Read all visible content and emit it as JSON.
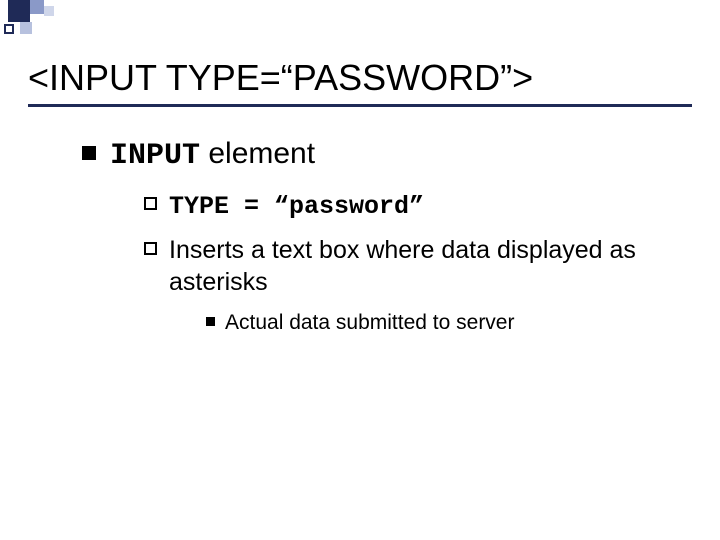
{
  "title": "<INPUT TYPE=“PASSWORD”>",
  "l1": {
    "prefix_mono": "INPUT",
    "suffix": " element"
  },
  "l2a": {
    "mono": "TYPE = “password”"
  },
  "l2b": {
    "text": "Inserts a text box where data displayed as asterisks"
  },
  "l3a": {
    "text": "Actual data submitted to server"
  }
}
